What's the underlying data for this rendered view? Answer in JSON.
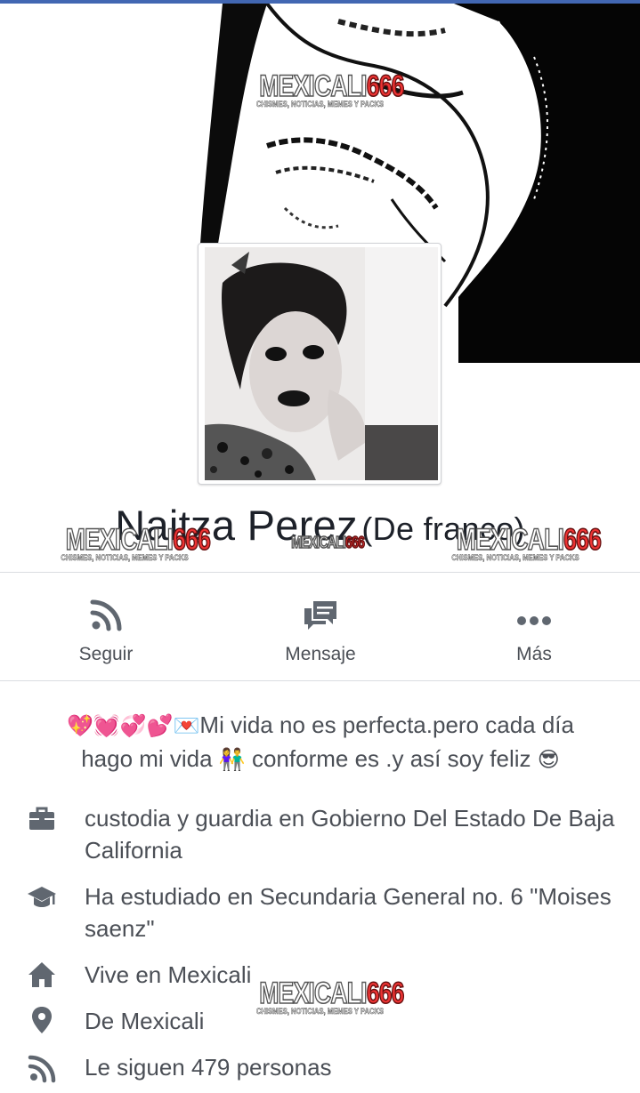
{
  "theme": {
    "accent": "#4267b2",
    "icon_color": "#606770",
    "text_color": "#4b4f56"
  },
  "watermark": {
    "brand": "MEXICALI",
    "number": "666",
    "tagline": "CHISMES, NOTICIAS, MEMES Y PACKS"
  },
  "profile": {
    "name": "Naitza Perez",
    "alt_name": "(De franco)"
  },
  "actions": [
    {
      "label": "Seguir",
      "icon": "rss-follow-icon"
    },
    {
      "label": "Mensaje",
      "icon": "message-bubbles-icon"
    },
    {
      "label": "Más",
      "icon": "more-dots-icon"
    }
  ],
  "bio": {
    "emojis_start": "💖💓💞💕💌",
    "line1": "Mi vida no es perfecta.pero cada día",
    "line2_a": "hago mi vida",
    "emoji_family": "👫",
    "line2_b": "conforme es .y así soy feliz",
    "emoji_end": "😎"
  },
  "intro": [
    {
      "icon": "briefcase-icon",
      "text": "custodia y guardia en Gobierno Del Estado De Baja California"
    },
    {
      "icon": "graduation-cap-icon",
      "text": "Ha estudiado en Secundaria General no. 6 \"Moises saenz\""
    },
    {
      "icon": "home-icon",
      "text": "Vive en Mexicali"
    },
    {
      "icon": "location-pin-icon",
      "text": "De Mexicali"
    },
    {
      "icon": "rss-follow-icon",
      "text": "Le siguen 479 personas"
    }
  ]
}
